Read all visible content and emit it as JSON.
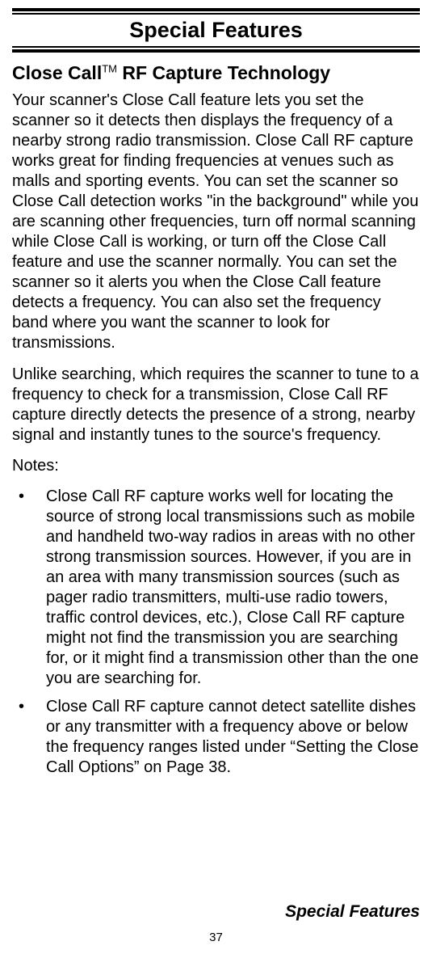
{
  "page": {
    "main_title": "Special Features",
    "section_title_prefix": "Close Call",
    "section_title_tm": "TM",
    "section_title_suffix": " RF Capture Technology",
    "para1": "Your scanner's Close Call feature lets you set the scanner so it detects then displays the frequency of a nearby strong radio transmission. Close Call RF capture works great for finding frequencies at venues such as malls and sporting events. You can set the scanner so Close Call detection works \"in the background\" while you are scanning other frequencies, turn off normal scanning while Close Call is working, or turn off the Close Call feature and use the scanner normally. You can set the scanner so it alerts you when the Close Call feature detects a frequency. You can also set the frequency band where you want the scanner to look for transmissions.",
    "para2": "Unlike searching, which requires the scanner to tune to a frequency to check for a transmission, Close Call RF capture directly detects the presence of a strong, nearby signal and instantly tunes to the source's frequency.",
    "notes_label": "Notes:",
    "bullets": [
      "Close Call RF capture works well for locating the source of strong local transmissions such as mobile and handheld two-way radios in areas with no other strong transmission sources. However, if you are in an area with many transmission sources (such as pager radio transmitters, multi-use radio towers, traffic control devices, etc.), Close Call RF capture might not find the transmission you are searching for, or it might find a transmission other than the one you are searching for.",
      "Close Call RF capture cannot detect satellite dishes or any transmitter with a frequency above or below the frequency ranges listed under “Setting the Close Call Options” on Page 38."
    ],
    "footer_title": "Special Features",
    "page_number": "37"
  }
}
